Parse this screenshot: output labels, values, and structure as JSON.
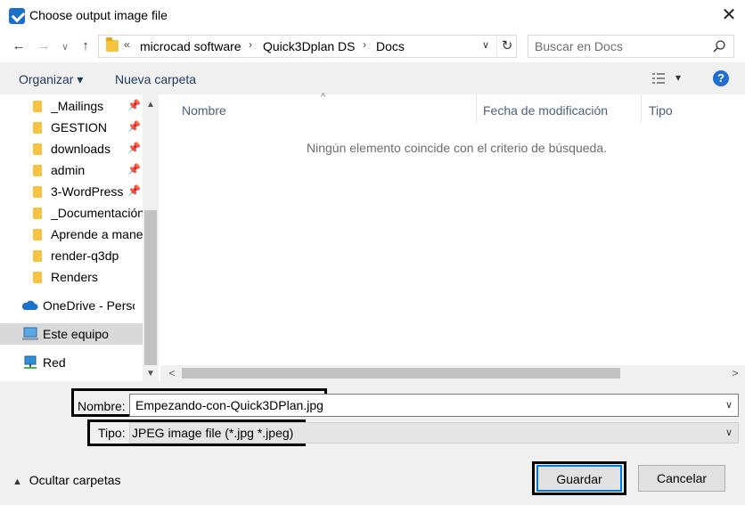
{
  "window": {
    "title": "Choose output image file",
    "close_glyph": "✕"
  },
  "nav_buttons": {
    "back": "←",
    "forward": "→",
    "recent": "∨",
    "up": "↑"
  },
  "address": {
    "overflow": "«",
    "separator": "›",
    "crumbs": [
      "microcad software",
      "Quick3Dplan DS",
      "Docs"
    ],
    "dropdown": "∨",
    "refresh": "↻"
  },
  "search": {
    "placeholder": "Buscar en Docs"
  },
  "commands": {
    "organize": "Organizar ▾",
    "new_folder": "Nueva carpeta",
    "view_menu": "▾",
    "help": "?"
  },
  "nav_pane": {
    "quick_access": [
      {
        "label": "_Mailings",
        "pinned": true
      },
      {
        "label": "GESTION",
        "pinned": true
      },
      {
        "label": "downloads",
        "pinned": true
      },
      {
        "label": "admin",
        "pinned": true
      },
      {
        "label": "3-WordPress",
        "pinned": true
      },
      {
        "label": "_Documentación",
        "pinned": false
      },
      {
        "label": "Aprende a manej",
        "pinned": false
      },
      {
        "label": "render-q3dp",
        "pinned": false
      },
      {
        "label": "Renders",
        "pinned": false
      }
    ],
    "roots": [
      {
        "label": "OneDrive - Person",
        "icon": "cloud-icon"
      },
      {
        "label": "Este equipo",
        "icon": "computer-icon",
        "selected": true
      },
      {
        "label": "Red",
        "icon": "network-icon"
      }
    ],
    "scroll_up": "▲",
    "scroll_down": "▼"
  },
  "file_list": {
    "columns": [
      "Nombre",
      "Fecha de modificación",
      "Tipo"
    ],
    "sort_indicator": "^",
    "empty_message": "Ningún elemento coincide con el criterio de búsqueda.",
    "scroll_left": "<",
    "scroll_right": ">"
  },
  "form": {
    "name_label": "Nombre:",
    "name_value": "Empezando-con-Quick3DPlan.jpg",
    "type_label": "Tipo:",
    "type_value": "JPEG image file (*.jpg *.jpeg)",
    "dropdown": "∨"
  },
  "footer": {
    "hide_folders": "Ocultar carpetas",
    "save": "Guardar",
    "cancel": "Cancelar"
  },
  "colors": {
    "accent": "#0078d7",
    "help_blue": "#1f6fd1",
    "folder_yellow": "#f6c342",
    "highlight_border": "#000000"
  }
}
